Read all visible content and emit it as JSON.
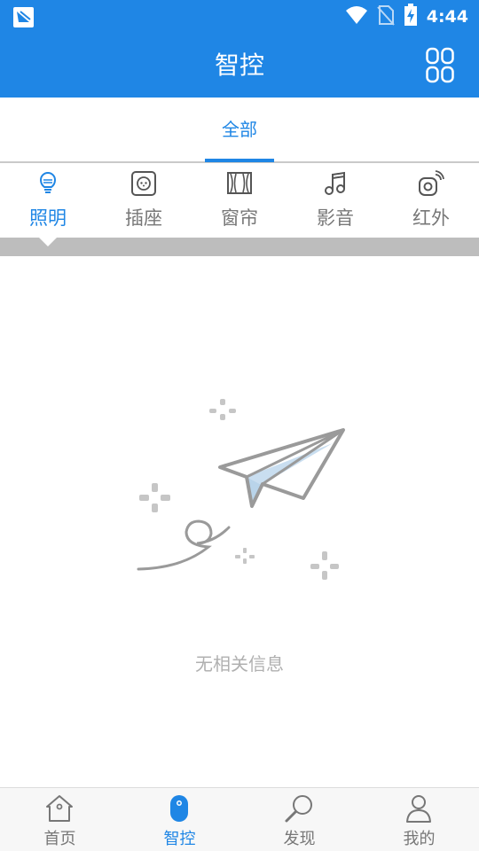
{
  "colors": {
    "primary": "#1f86e5",
    "inactive": "#777777",
    "divider_bar": "#bdbdbd",
    "empty_text": "#b0b0b0"
  },
  "status_bar": {
    "time": "4:44",
    "icons": [
      "app-notification-icon",
      "wifi-icon",
      "no-sim-icon",
      "battery-charging-icon"
    ]
  },
  "app_bar": {
    "title": "智控",
    "right_icon": "grid-icon"
  },
  "tabs": [
    {
      "label": "全部",
      "selected": true
    }
  ],
  "categories": [
    {
      "label": "照明",
      "icon": "bulb-icon",
      "selected": true
    },
    {
      "label": "插座",
      "icon": "socket-icon",
      "selected": false
    },
    {
      "label": "窗帘",
      "icon": "curtain-icon",
      "selected": false
    },
    {
      "label": "影音",
      "icon": "music-icon",
      "selected": false
    },
    {
      "label": "红外",
      "icon": "infrared-icon",
      "selected": false
    }
  ],
  "empty_state": {
    "icon": "paper-plane-icon",
    "message": "无相关信息"
  },
  "bottom_nav": [
    {
      "label": "首页",
      "icon": "home-icon",
      "selected": false
    },
    {
      "label": "智控",
      "icon": "control-icon",
      "selected": true
    },
    {
      "label": "发现",
      "icon": "discover-icon",
      "selected": false
    },
    {
      "label": "我的",
      "icon": "profile-icon",
      "selected": false
    }
  ]
}
